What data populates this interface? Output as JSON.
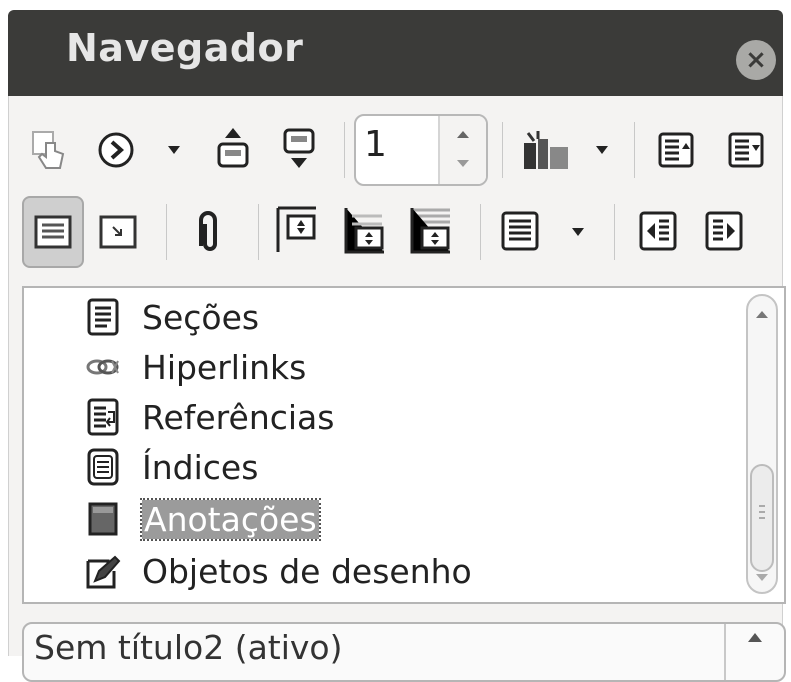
{
  "window": {
    "title": "Navegador",
    "close_glyph": "×"
  },
  "toolbar": {
    "row1": [
      {
        "name": "toggle-button",
        "icon": "hand-pointer-icon"
      },
      {
        "name": "navigation-button",
        "icon": "circle-arrow-icon"
      },
      {
        "name": "navigation-dropdown",
        "icon": "dropdown-arrow-icon"
      },
      {
        "name": "previous-button",
        "icon": "previous-object-icon"
      },
      {
        "name": "next-button",
        "icon": "next-object-icon"
      },
      {
        "name": "drag-mode-button",
        "icon": "drag-mode-icon"
      },
      {
        "name": "drag-mode-dropdown",
        "icon": "dropdown-arrow-icon"
      },
      {
        "name": "set-reminder-button",
        "icon": "reminder-icon"
      },
      {
        "name": "header-button",
        "icon": "header-icon"
      }
    ],
    "page_number": "1",
    "row2": [
      {
        "name": "list-box-button",
        "icon": "list-box-icon",
        "pressed": true
      },
      {
        "name": "content-view-button",
        "icon": "content-view-icon"
      },
      {
        "name": "footnote-anchor-button",
        "icon": "paperclip-icon"
      },
      {
        "name": "promote-chapter-button",
        "icon": "promote-chapter-icon"
      },
      {
        "name": "demote-chapter-button",
        "icon": "demote-chapter-icon"
      },
      {
        "name": "heading-levels-button",
        "icon": "heading-levels-icon"
      },
      {
        "name": "outline-level-button",
        "icon": "outline-level-icon"
      },
      {
        "name": "outline-level-dropdown",
        "icon": "dropdown-arrow-icon"
      },
      {
        "name": "promote-level-button",
        "icon": "promote-level-icon"
      },
      {
        "name": "demote-level-button",
        "icon": "demote-level-icon"
      }
    ]
  },
  "list": {
    "items": [
      {
        "label": "Seções",
        "icon": "sections-icon"
      },
      {
        "label": "Hiperlinks",
        "icon": "hyperlink-icon"
      },
      {
        "label": "Referências",
        "icon": "references-icon"
      },
      {
        "label": "Índices",
        "icon": "indexes-icon"
      },
      {
        "label": "Anotações",
        "icon": "comments-icon",
        "selected": true
      },
      {
        "label": "Objetos de desenho",
        "icon": "drawing-objects-icon"
      }
    ]
  },
  "document_select": {
    "value": "Sem título2 (ativo)"
  },
  "colors": {
    "titlebar": "#3b3b39",
    "panel": "#f4f3f2",
    "selection": "#9b9b9b"
  }
}
